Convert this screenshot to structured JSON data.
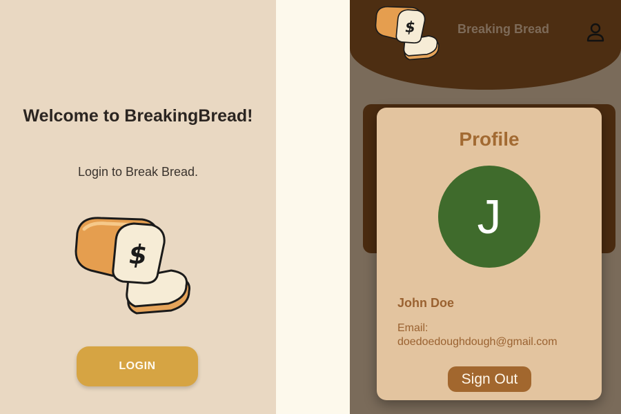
{
  "login_screen": {
    "welcome_title": "Welcome to BreakingBread!",
    "subtitle": "Login to Break Bread.",
    "logo_icon": "bread-loaf-dollar-icon",
    "login_button_label": "LOGIN"
  },
  "app_header": {
    "app_name": "Breaking Bread",
    "logo_icon": "bread-loaf-dollar-icon",
    "user_icon": "user-profile-icon"
  },
  "profile_modal": {
    "title": "Profile",
    "avatar_initial": "J",
    "user_name": "John Doe",
    "email_label": "Email:",
    "email_value": "doedoedoughdough@gmail.com",
    "sign_out_label": "Sign Out"
  },
  "colors": {
    "login_background": "#e9d8c2",
    "login_button": "#d6a443",
    "header_brown": "#4d2e12",
    "modal_background": "#e3c49f",
    "avatar_green": "#3f6b2c",
    "accent_brown": "#a2672e"
  }
}
